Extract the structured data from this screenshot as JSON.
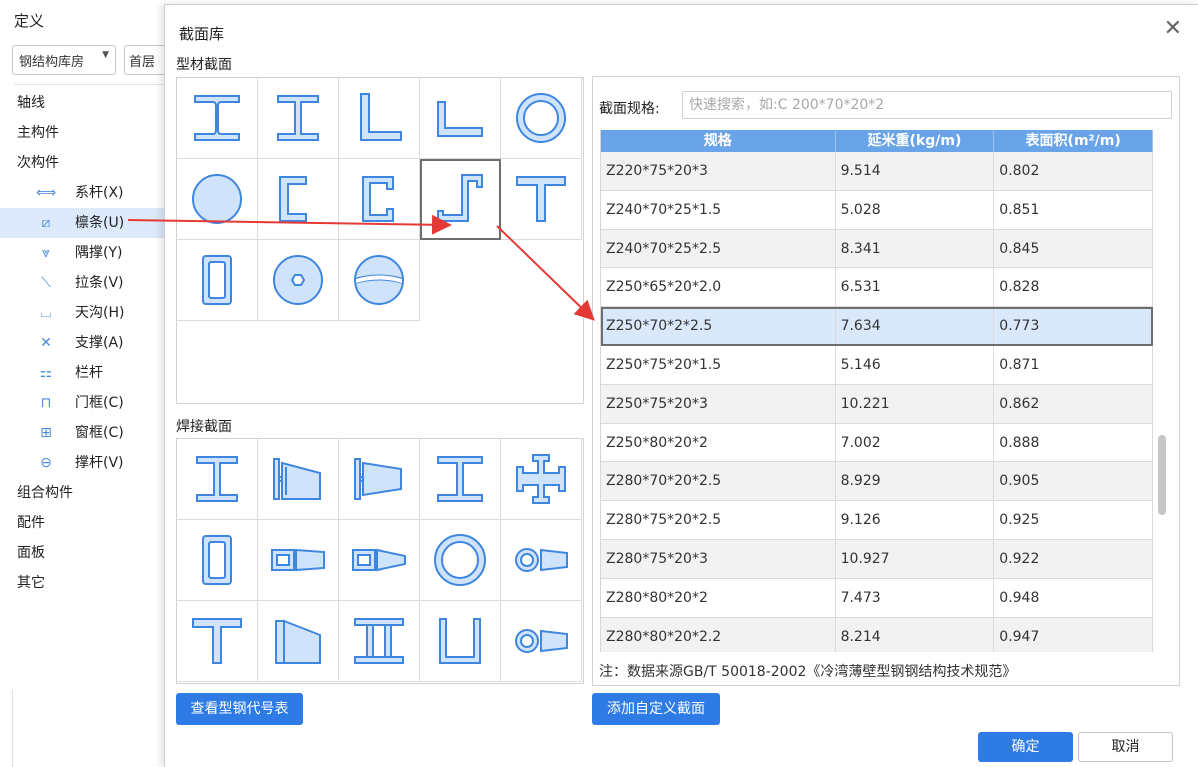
{
  "background": {
    "title": "定义",
    "building_select": "钢结构库房",
    "floor": "首层",
    "tree": [
      {
        "label": "轴线",
        "level": 0,
        "icon": ""
      },
      {
        "label": "主构件",
        "level": 0,
        "icon": ""
      },
      {
        "label": "次构件",
        "level": 0,
        "icon": ""
      },
      {
        "label": "系杆(X)",
        "level": 1,
        "icon": "tie-rod-icon"
      },
      {
        "label": "檩条(U)",
        "level": 1,
        "icon": "purlin-icon",
        "selected": true
      },
      {
        "label": "隅撑(Y)",
        "level": 1,
        "icon": "corner-brace-icon"
      },
      {
        "label": "拉条(V)",
        "level": 1,
        "icon": "tension-bar-icon"
      },
      {
        "label": "天沟(H)",
        "level": 1,
        "icon": "gutter-icon"
      },
      {
        "label": "支撑(A)",
        "level": 1,
        "icon": "bracing-icon"
      },
      {
        "label": "栏杆",
        "level": 1,
        "icon": "railing-icon"
      },
      {
        "label": "门框(C)",
        "level": 1,
        "icon": "door-frame-icon"
      },
      {
        "label": "窗框(C)",
        "level": 1,
        "icon": "window-frame-icon"
      },
      {
        "label": "撑杆(V)",
        "level": 1,
        "icon": "strut-icon"
      },
      {
        "label": "组合构件",
        "level": 0,
        "icon": ""
      },
      {
        "label": "配件",
        "level": 0,
        "icon": ""
      },
      {
        "label": "面板",
        "level": 0,
        "icon": ""
      },
      {
        "label": "其它",
        "level": 0,
        "icon": ""
      }
    ]
  },
  "dialog": {
    "title": "截面库",
    "profile_group_label": "型材截面",
    "welded_group_label": "焊接截面",
    "view_codes_button": "查看型钢代号表",
    "add_custom_button": "添加自定义截面",
    "ok_button": "确定",
    "cancel_button": "取消",
    "search_label": "截面规格:",
    "search_placeholder": "快速搜索，如:C 200*70*20*2",
    "search_value": "",
    "table": {
      "headers": [
        "规格",
        "延米重(kg/m)",
        "表面积(m²/m)"
      ],
      "rows": [
        {
          "spec": "Z220*75*20*3",
          "weight": "9.514",
          "area": "0.802"
        },
        {
          "spec": "Z240*70*25*1.5",
          "weight": "5.028",
          "area": "0.851"
        },
        {
          "spec": "Z240*70*25*2.5",
          "weight": "8.341",
          "area": "0.845"
        },
        {
          "spec": "Z250*65*20*2.0",
          "weight": "6.531",
          "area": "0.828"
        },
        {
          "spec": "Z250*70*2*2.5",
          "weight": "7.634",
          "area": "0.773",
          "selected": true
        },
        {
          "spec": "Z250*75*20*1.5",
          "weight": "5.146",
          "area": "0.871"
        },
        {
          "spec": "Z250*75*20*3",
          "weight": "10.221",
          "area": "0.862"
        },
        {
          "spec": "Z250*80*20*2",
          "weight": "7.002",
          "area": "0.888"
        },
        {
          "spec": "Z280*70*20*2.5",
          "weight": "8.929",
          "area": "0.905"
        },
        {
          "spec": "Z280*75*20*2.5",
          "weight": "9.126",
          "area": "0.925"
        },
        {
          "spec": "Z280*75*20*3",
          "weight": "10.927",
          "area": "0.922"
        },
        {
          "spec": "Z280*80*20*2",
          "weight": "7.473",
          "area": "0.948"
        },
        {
          "spec": "Z280*80*20*2.2",
          "weight": "8.214",
          "area": "0.947"
        }
      ]
    },
    "note": "注：数据来源GB/T 50018-2002《冷湾薄壁型钢钢结构技术规范》",
    "profile_sections": [
      "i-beam-icon",
      "h-beam-icon",
      "unequal-angle-icon",
      "equal-angle-icon",
      "round-tube-icon",
      "round-bar-icon",
      "channel-icon",
      "lipped-channel-icon",
      "z-section-icon",
      "t-section-icon",
      "rect-tube-icon",
      "hex-hole-disk-icon",
      "split-circle-icon"
    ],
    "welded_sections": [
      "welded-i-beam-icon",
      "tapered-i-beam-icon",
      "tapered-i-beam-2-icon",
      "welded-h-icon",
      "cross-section-icon",
      "welded-box-icon",
      "box-tapered-icon",
      "box-tapered-2-icon",
      "welded-round-tube-icon",
      "round-tapered-icon",
      "welded-t-icon",
      "tapered-t-icon",
      "double-i-icon",
      "u-section-icon",
      "round-tapered-2-icon"
    ],
    "colors": {
      "accent": "#2e7be6",
      "header": "#6aa4e8",
      "shape_fill": "#cfe3fb",
      "shape_stroke": "#3f86e0",
      "arrow": "#e53935"
    }
  }
}
